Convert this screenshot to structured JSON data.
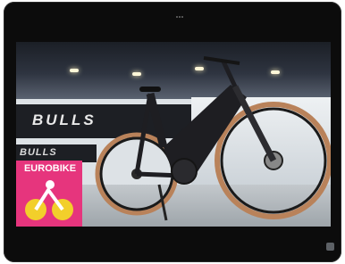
{
  "banner": {
    "brand": "BULLS",
    "brand_small": "BULLS"
  },
  "eurobike": {
    "label": "EUROBIKE"
  },
  "colors": {
    "eurobike_pink": "#e6357d",
    "tablet_frame": "#0c0c0c",
    "tire_gum": "#b9825a"
  },
  "icons": {
    "camera": "camera-dots-icon",
    "home": "home-button-icon"
  }
}
